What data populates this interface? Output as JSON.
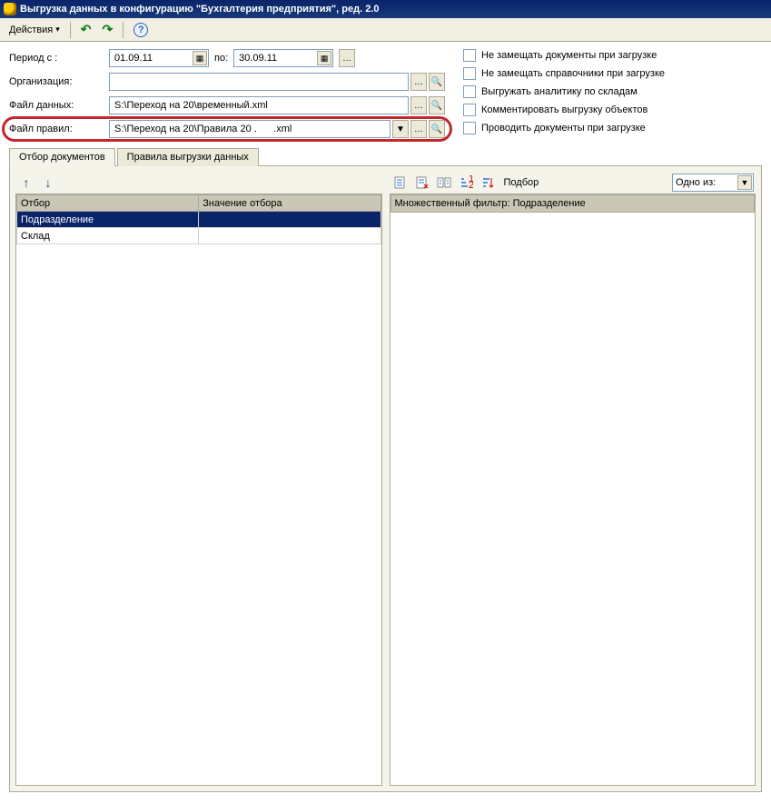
{
  "title": "Выгрузка данных в конфигурацию \"Бухгалтерия предприятия\", ред. 2.0",
  "toolbar": {
    "actions_label": "Действия"
  },
  "form": {
    "period_label": "Период с :",
    "date_from": "01.09.11",
    "to_label": "по:",
    "date_to": "30.09.11",
    "org_label": "Организация:",
    "org_value": "",
    "data_file_label": "Файл данных:",
    "data_file_value": "S:\\Переход на 20\\временный.xml",
    "rules_file_label": "Файл правил:",
    "rules_file_value": "S:\\Переход на 20\\Правила 20 .      .xml"
  },
  "checks": {
    "c1": "Не замещать документы при загрузке",
    "c2": "Не замещать справочники при загрузке",
    "c3": "Выгружать аналитику по складам",
    "c4": "Комментировать выгрузку объектов",
    "c5": "Проводить документы при загрузке"
  },
  "tabs": {
    "t1": "Отбор документов",
    "t2": "Правила выгрузки данных"
  },
  "left_grid": {
    "col1": "Отбор",
    "col2": "Значение отбора",
    "rows": [
      {
        "c1": "Подразделение",
        "c2": ""
      },
      {
        "c1": "Склад",
        "c2": ""
      }
    ]
  },
  "right_pane": {
    "podbor": "Подбор",
    "combo_value": "Одно из:",
    "header": "Множественный фильтр: Подразделение"
  }
}
